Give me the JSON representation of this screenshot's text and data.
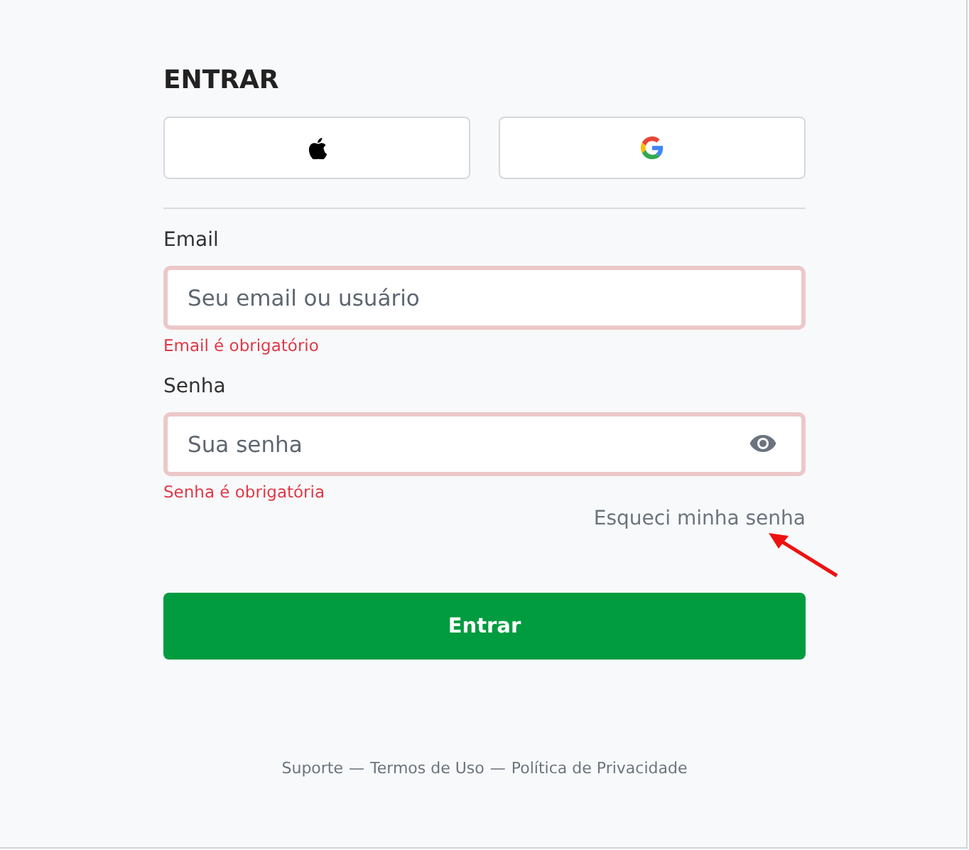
{
  "title": "ENTRAR",
  "social_buttons": [
    {
      "kind": "apple"
    },
    {
      "kind": "google"
    }
  ],
  "fields": [
    {
      "label": "Email",
      "placeholder": "Seu email ou usuário",
      "invalid": true,
      "error": "Email é obrigatório",
      "kind": "text"
    },
    {
      "label": "Senha",
      "placeholder": "Sua senha",
      "invalid": true,
      "error": "Senha é obrigatória",
      "kind": "password"
    }
  ],
  "forgot_link": "Esqueci minha senha",
  "submit_button": "Entrar",
  "footer": {
    "separator": "—",
    "links": [
      "Suporte",
      "Termos de Uso",
      "Política de Privacidade"
    ]
  }
}
